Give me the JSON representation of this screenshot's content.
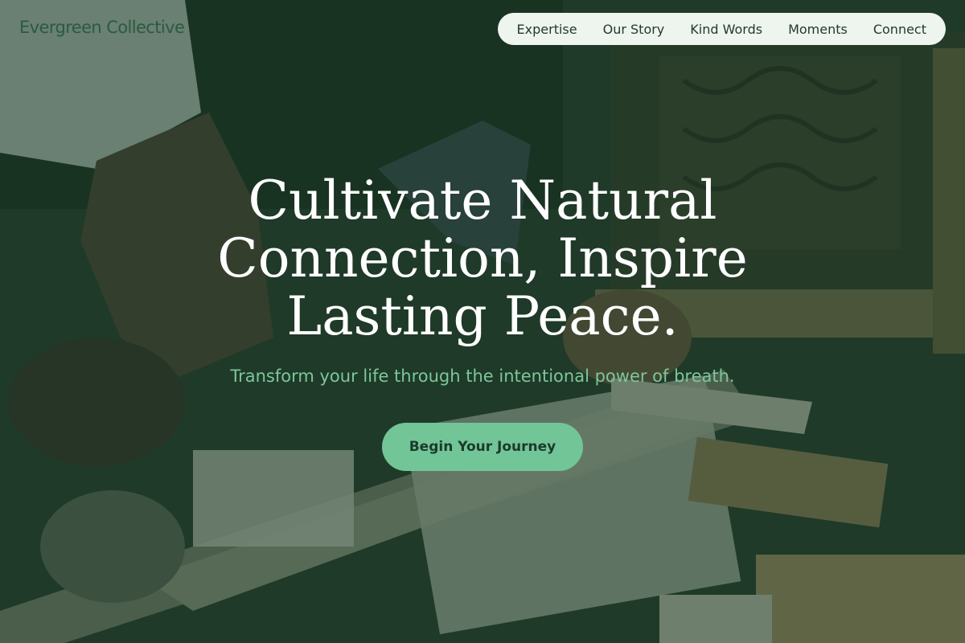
{
  "brand": {
    "name": "Evergreen Collective"
  },
  "nav": {
    "items": [
      {
        "label": "Expertise"
      },
      {
        "label": "Our Story"
      },
      {
        "label": "Kind Words"
      },
      {
        "label": "Moments"
      },
      {
        "label": "Connect"
      }
    ]
  },
  "hero": {
    "headline_lines": [
      "Cultivate Natural",
      "Connection, Inspire",
      "Lasting Peace."
    ],
    "subline": "Transform your life through the intentional power of breath.",
    "cta_label": "Begin Your Journey",
    "background_image": "woodworker-carving-wood-photo"
  },
  "colors": {
    "overlay": "#163a26",
    "accent": "#72c597",
    "subline": "#7cc79b",
    "nav_bg": "#eef4ee",
    "brand": "#2c5a40"
  }
}
